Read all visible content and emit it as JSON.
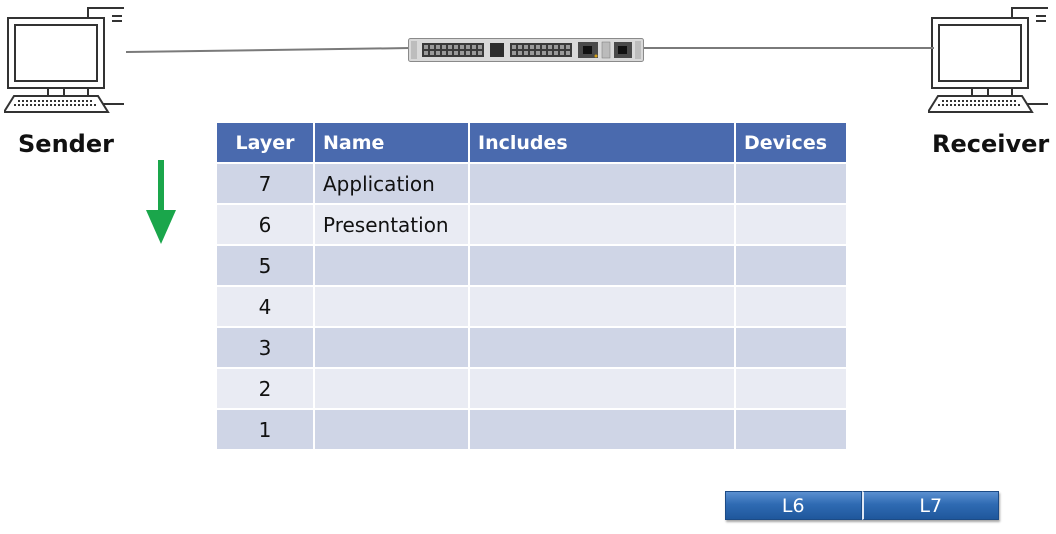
{
  "hosts": {
    "sender": {
      "label": "Sender",
      "icon": "desktop-computer-icon"
    },
    "receiver": {
      "label": "Receiver",
      "icon": "desktop-computer-icon"
    }
  },
  "network": {
    "device_icon": "network-switch-icon",
    "cable_color": "#7a7a7a"
  },
  "direction_arrow": {
    "icon": "down-arrow-icon",
    "color": "#1aa64b"
  },
  "osi_table": {
    "headers": [
      "Layer",
      "Name",
      "Includes",
      "Devices"
    ],
    "header_color": "#4a6aae",
    "rows": [
      {
        "layer": "7",
        "name": "Application",
        "includes": "",
        "devices": ""
      },
      {
        "layer": "6",
        "name": "Presentation",
        "includes": "",
        "devices": ""
      },
      {
        "layer": "5",
        "name": "",
        "includes": "",
        "devices": ""
      },
      {
        "layer": "4",
        "name": "",
        "includes": "",
        "devices": ""
      },
      {
        "layer": "3",
        "name": "",
        "includes": "",
        "devices": ""
      },
      {
        "layer": "2",
        "name": "",
        "includes": "",
        "devices": ""
      },
      {
        "layer": "1",
        "name": "",
        "includes": "",
        "devices": ""
      }
    ]
  },
  "pdu": {
    "segments": [
      "L6",
      "L7"
    ],
    "color": "#2f6bb3"
  }
}
